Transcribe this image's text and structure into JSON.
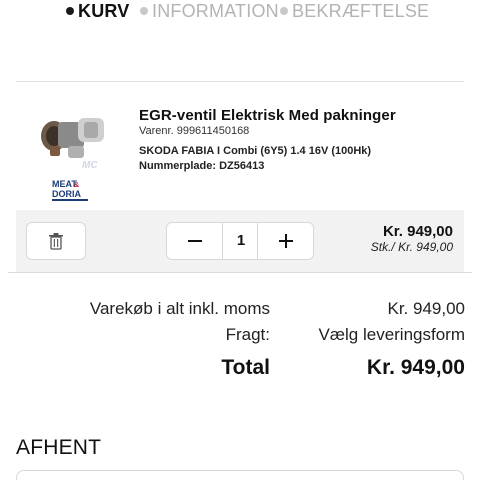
{
  "steps": {
    "items": [
      {
        "label": "KURV",
        "active": true
      },
      {
        "label": "INFORMATION",
        "active": false
      },
      {
        "label": "BEKRÆFTELSE",
        "active": false
      }
    ]
  },
  "product": {
    "title": "EGR-ventil Elektrisk Med pakninger",
    "sku": "Varenr. 999611450168",
    "car": "SKODA FABIA I Combi (6Y5) 1.4 16V (100Hk)",
    "plate": "Nummerplade: DZ56413",
    "brand_logo_text": "MEAT & DORIA",
    "image_icon": "egr-valve-image",
    "quantity": "1",
    "price": "Kr. 949,00",
    "unit_price": "Stk./ Kr. 949,00"
  },
  "summary": {
    "subtotal_label": "Varekøb i alt inkl. moms",
    "subtotal_value": "Kr. 949,00",
    "shipping_label": "Fragt:",
    "shipping_value": "Vælg leveringsform",
    "total_label": "Total",
    "total_value": "Kr. 949,00"
  },
  "pickup": {
    "heading": "AFHENT"
  },
  "colors": {
    "active_step": "#1a1a1a",
    "inactive_step": "#b3b3b3",
    "action_bar_bg": "#f2f2f2"
  }
}
